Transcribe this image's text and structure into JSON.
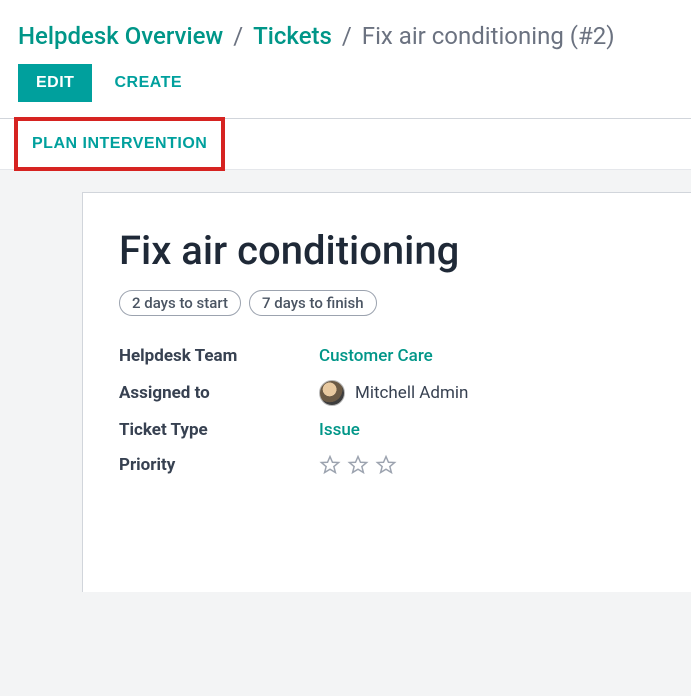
{
  "breadcrumb": {
    "overview": "Helpdesk Overview",
    "tickets": "Tickets",
    "current": "Fix air conditioning (#2)",
    "sep": "/"
  },
  "actions": {
    "edit": "EDIT",
    "create": "CREATE",
    "plan": "PLAN INTERVENTION"
  },
  "ticket": {
    "title": "Fix air conditioning",
    "tags": {
      "start": "2 days to start",
      "finish": "7 days to finish"
    },
    "fields": {
      "helpdesk_team_label": "Helpdesk Team",
      "helpdesk_team_value": "Customer Care",
      "assigned_label": "Assigned to",
      "assigned_value": "Mitchell Admin",
      "type_label": "Ticket Type",
      "type_value": "Issue",
      "priority_label": "Priority"
    }
  }
}
